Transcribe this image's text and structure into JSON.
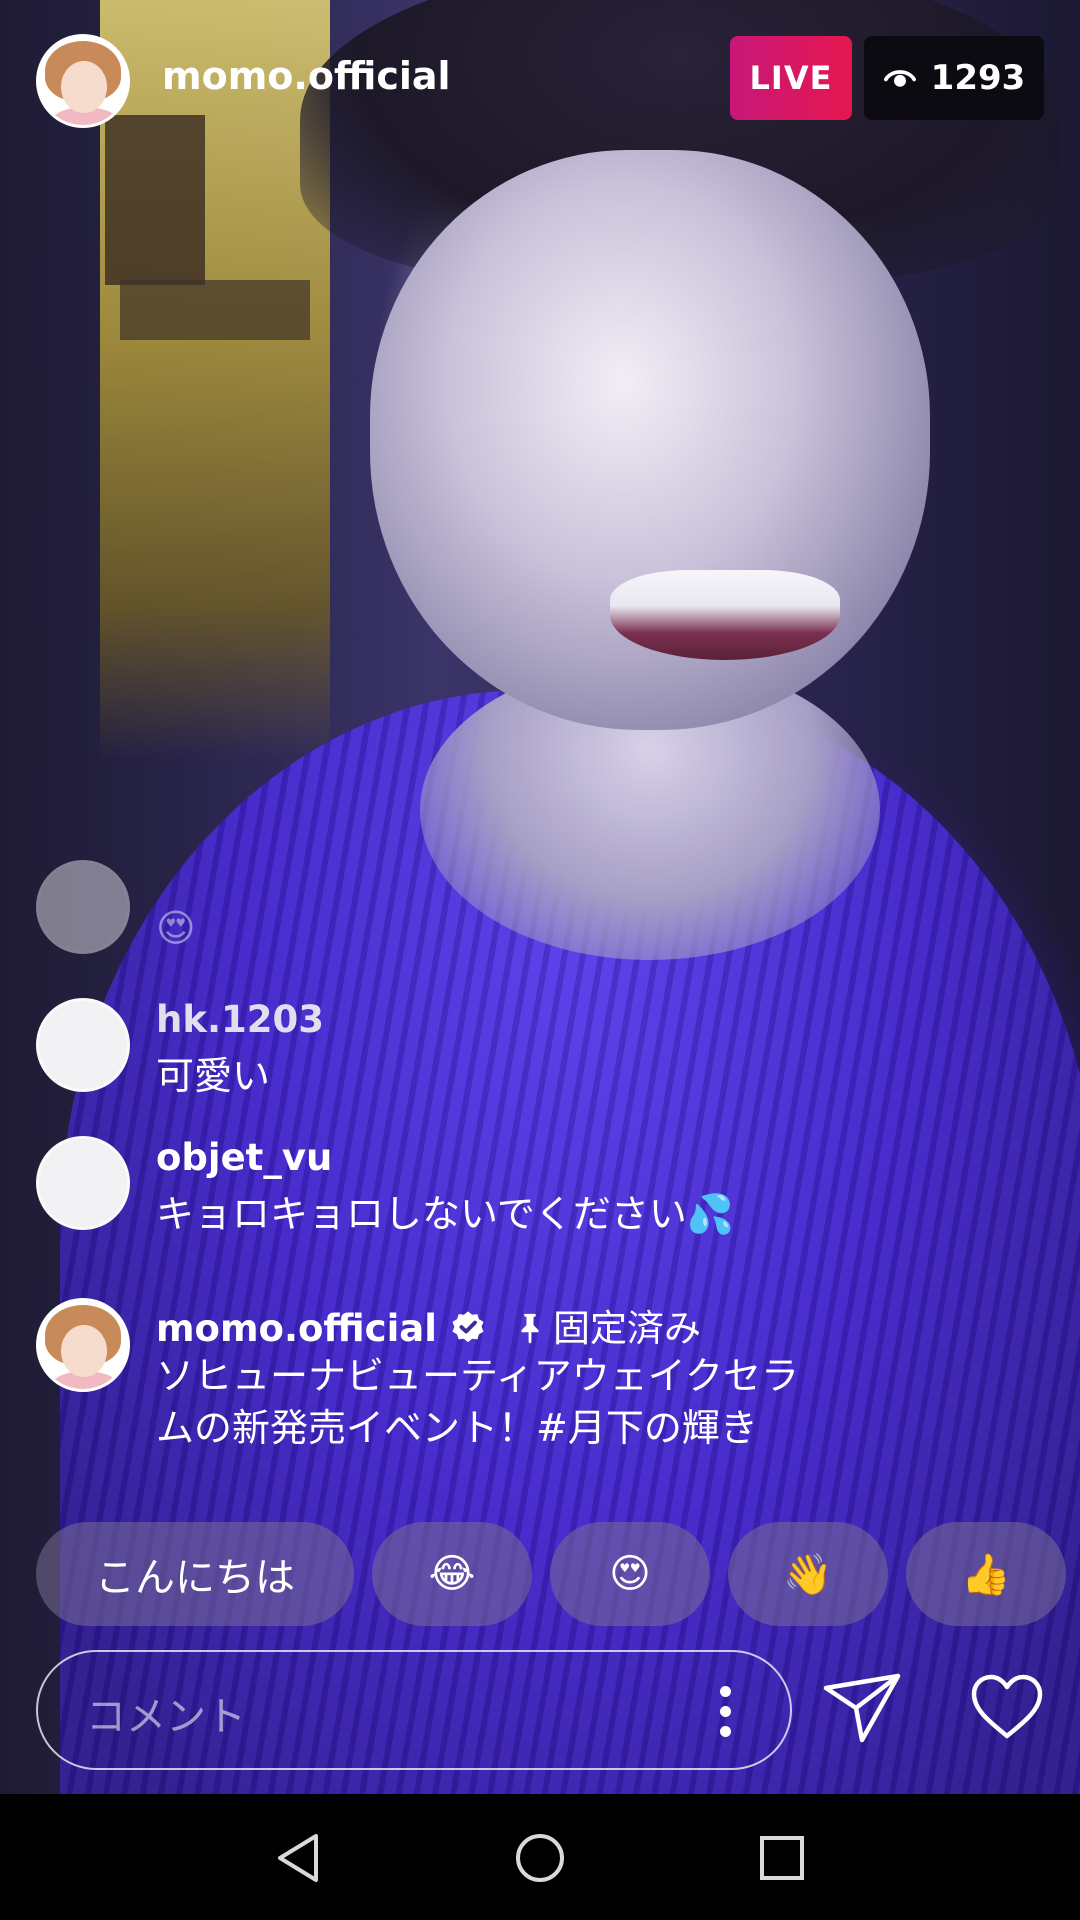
{
  "header": {
    "username": "momo.official",
    "live_label": "LIVE",
    "viewer_count": "1293"
  },
  "comments": [
    {
      "name": "",
      "text": "😍",
      "faded": true
    },
    {
      "name": "hk.1203",
      "text": "可愛い"
    },
    {
      "name": "objet_vu",
      "text": "キョロキョロしないでください💦"
    },
    {
      "name": "momo.official",
      "verified": true,
      "pinned_label": "固定済み",
      "text_line1": "ソヒューナビューティアウェイクセラ",
      "text_line2": "ムの新発売イベント！#月下の輝き"
    }
  ],
  "quick_replies": [
    "こんにちは",
    "😂",
    "😍",
    "👋",
    "👍"
  ],
  "comment_bar": {
    "placeholder": "コメント"
  },
  "icons": {
    "viewers": "eye-icon",
    "verified": "verified-badge-icon",
    "pinned": "pin-icon",
    "more": "more-vertical-icon",
    "send": "send-icon",
    "like": "heart-icon",
    "nav_back": "back-triangle-icon",
    "nav_home": "home-circle-icon",
    "nav_recents": "recents-square-icon"
  },
  "colors": {
    "live_badge": "#e5174e",
    "viewer_badge": "#0a0a0e",
    "navbar": "#000000"
  }
}
